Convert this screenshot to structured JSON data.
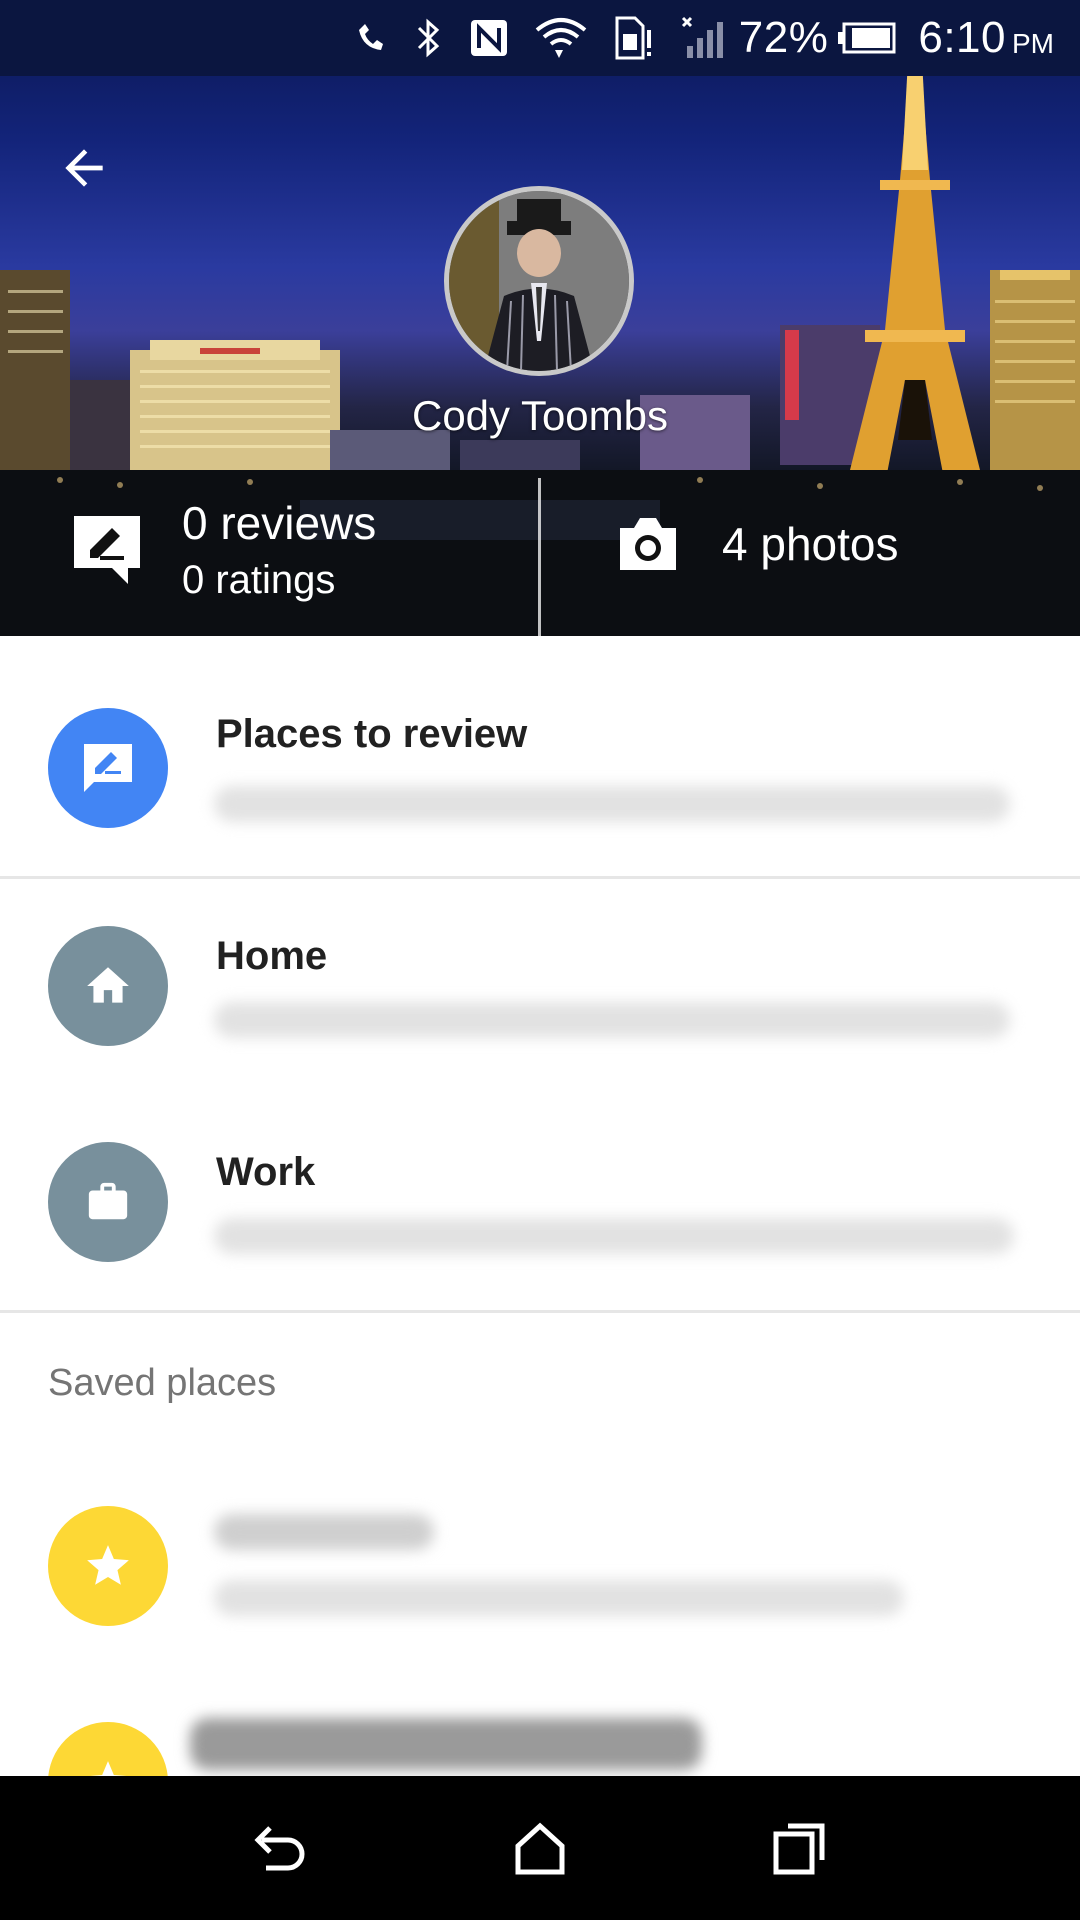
{
  "status_bar": {
    "battery_percent": "72%",
    "time": "6:10",
    "ampm": "PM",
    "icons": [
      "call-forward-icon",
      "bluetooth-icon",
      "nfc-icon",
      "wifi-icon",
      "sim-alert-icon",
      "signal-icon",
      "battery-icon"
    ]
  },
  "header": {
    "back_icon": "arrow-back-icon",
    "profile_name": "Cody Toombs",
    "reviews": "0 reviews",
    "ratings": "0 ratings",
    "photos": "4 photos"
  },
  "list": {
    "places_to_review": {
      "title": "Places to review",
      "icon": "rate-review-icon",
      "color": "#4285f4"
    },
    "home": {
      "title": "Home",
      "icon": "home-icon",
      "color": "#78909c"
    },
    "work": {
      "title": "Work",
      "icon": "briefcase-icon",
      "color": "#78909c"
    }
  },
  "saved_places": {
    "header": "Saved places",
    "star_color": "#fdd835",
    "icon": "star-icon"
  },
  "nav_bar": {
    "icons": [
      "back-icon",
      "home-icon",
      "recents-icon"
    ]
  }
}
